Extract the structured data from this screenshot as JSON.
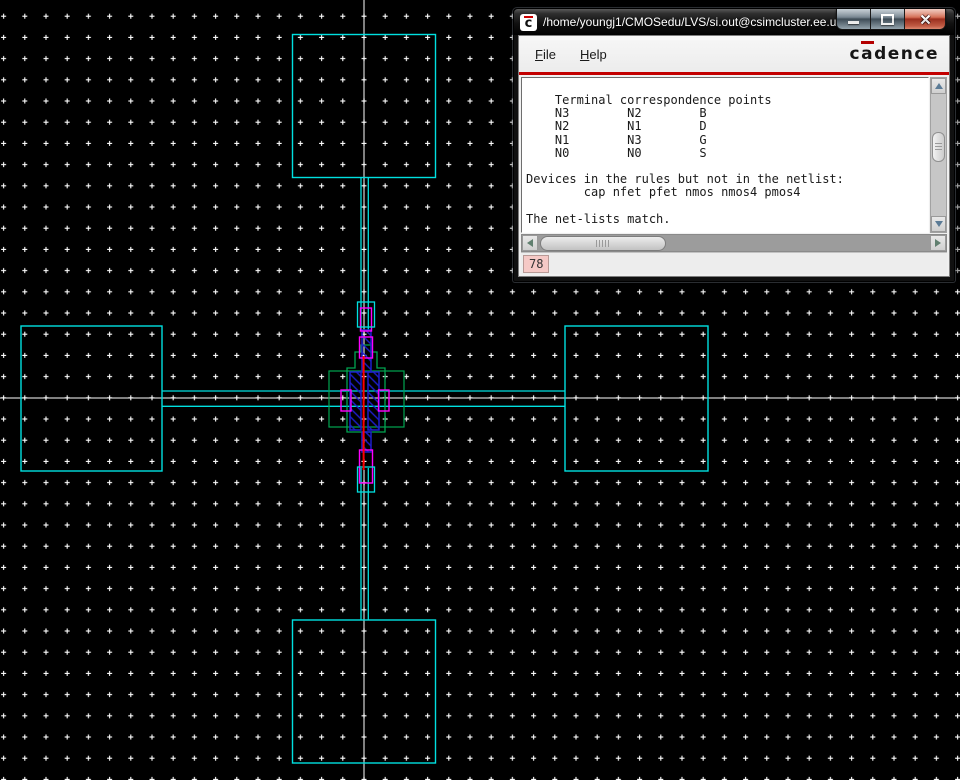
{
  "app": {
    "window_title": "/home/youngj1/CMOSedu/LVS/si.out@csimcluster.ee.u...",
    "icon_letter": "c",
    "menu": {
      "file_accel": "F",
      "file_rest": "ile",
      "help_accel": "H",
      "help_rest": "elp"
    },
    "logo": {
      "pre": "c",
      "macron": "a",
      "rest": "dence"
    },
    "terminal": {
      "lines": [
        "    Terminal correspondence points",
        "    N3        N2        B",
        "    N2        N1        D",
        "    N1        N3        G",
        "    N0        N0        S",
        "",
        "Devices in the rules but not in the netlist:",
        "        cap nfet pfet nmos nmos4 pmos4",
        "",
        "The net-lists match."
      ]
    },
    "status_value": "78"
  },
  "canvas": {
    "colors": {
      "metal": "#00E0E0",
      "active": "#00A550",
      "contact": "#1E1ECC",
      "poly": "#FF00FF",
      "gate": "#FF0000",
      "grid": "#FFFFFF",
      "axis": "#FFFFFF"
    }
  }
}
